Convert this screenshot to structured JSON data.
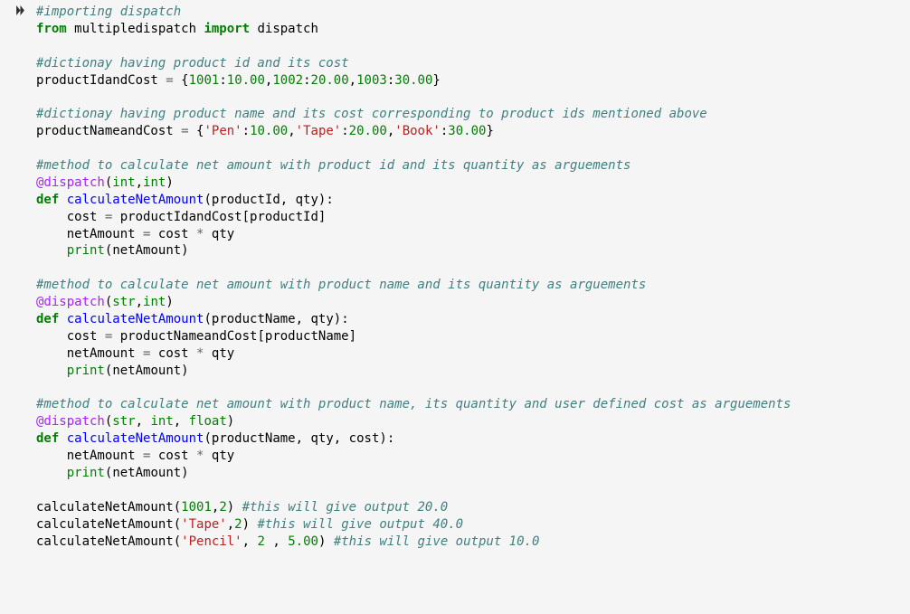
{
  "code_lines": {
    "l1_cmt": "#importing dispatch",
    "l2_from": "from",
    "l2_mod": "multipledispatch",
    "l2_import": "import",
    "l2_name": "dispatch",
    "l4_cmt": "#dictionay having product id and its cost",
    "l5_var": "productIdandCost",
    "l5_eq": "=",
    "l5_lb": "{",
    "l5_k1": "1001",
    "l5_v1": "10.00",
    "l5_k2": "1002",
    "l5_v2": "20.00",
    "l5_k3": "1003",
    "l5_v3": "30.00",
    "l5_rb": "}",
    "l7_cmt": "#dictionay having product name and its cost corresponding to product ids mentioned above",
    "l8_var": "productNameandCost",
    "l8_k1": "'Pen'",
    "l8_v1": "10.00",
    "l8_k2": "'Tape'",
    "l8_v2": "20.00",
    "l8_k3": "'Book'",
    "l8_v3": "30.00",
    "l10_cmt": "#method to calculate net amount with product id and its quantity as arguements",
    "l11_dec": "@dispatch",
    "l11_t1": "int",
    "l11_t2": "int",
    "l12_def": "def",
    "l12_fn": "calculateNetAmount",
    "l12_a1": "productId",
    "l12_a2": "qty",
    "l13_txt_a": "cost",
    "l13_txt_b": "productIdandCost[productId]",
    "l14_txt_a": "netAmount",
    "l14_txt_b": "cost",
    "l14_txt_c": "qty",
    "l15_print": "print",
    "l15_arg": "netAmount",
    "l17_cmt": "#method to calculate net amount with product name and its quantity as arguements",
    "l18_t1": "str",
    "l18_t2": "int",
    "l19_a1": "productName",
    "l19_a2": "qty",
    "l20_txt_b": "productNameandCost[productName]",
    "l24_cmt": "#method to calculate net amount with product name, its quantity and user defined cost as arguements",
    "l25_t1": "str",
    "l25_t2": "int",
    "l25_t3": "float",
    "l26_a1": "productName",
    "l26_a2": "qty",
    "l26_a3": "cost",
    "l30_arg1": "1001",
    "l30_arg2": "2",
    "l30_cmt": "#this will give output 20.0",
    "l31_arg1": "'Tape'",
    "l31_arg2": "2",
    "l31_cmt": "#this will give output 40.0",
    "l32_arg1": "'Pencil'",
    "l32_arg2": "2",
    "l32_arg3": "5.00",
    "l32_cmt": "#this will give output 10.0",
    "star": "*",
    "colon": ":",
    "comma": ",",
    "lpar": "(",
    "rpar": ")",
    "space": " "
  }
}
